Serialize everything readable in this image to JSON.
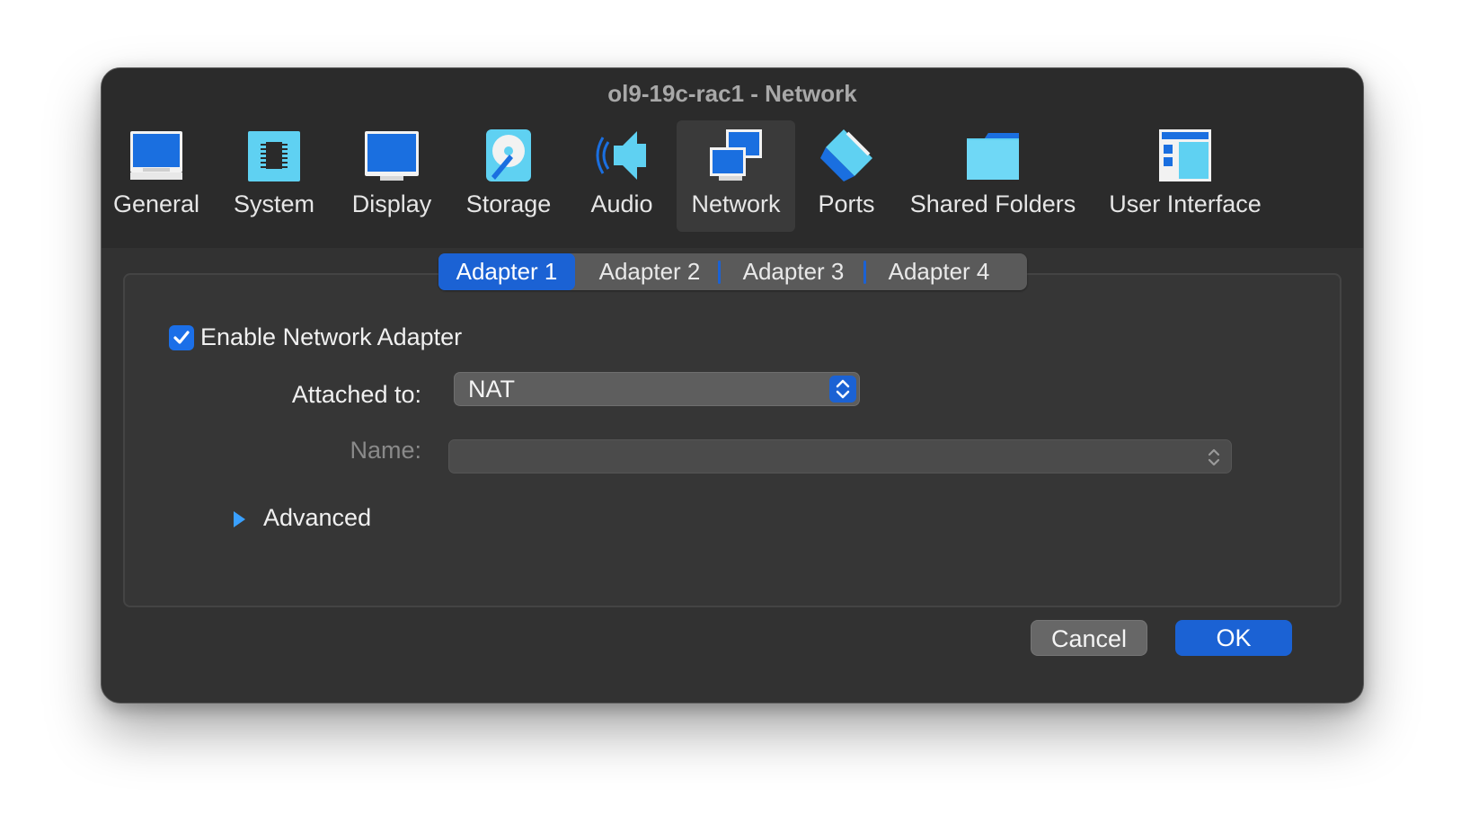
{
  "window": {
    "title": "ol9-19c-rac1 - Network"
  },
  "toolbar": {
    "items": [
      {
        "label": "General",
        "icon": "general-icon"
      },
      {
        "label": "System",
        "icon": "system-chip-icon"
      },
      {
        "label": "Display",
        "icon": "display-monitor-icon"
      },
      {
        "label": "Storage",
        "icon": "storage-disk-icon"
      },
      {
        "label": "Audio",
        "icon": "audio-speaker-icon"
      },
      {
        "label": "Network",
        "icon": "network-icon",
        "selected": true
      },
      {
        "label": "Ports",
        "icon": "ports-plug-icon"
      },
      {
        "label": "Shared Folders",
        "icon": "folder-icon"
      },
      {
        "label": "User Interface",
        "icon": "user-interface-icon"
      }
    ]
  },
  "adapters": {
    "tabs": [
      "Adapter 1",
      "Adapter 2",
      "Adapter 3",
      "Adapter 4"
    ],
    "selected": "Adapter 1"
  },
  "form": {
    "enable_label": "Enable Network Adapter",
    "enable_checked": true,
    "attached_label": "Attached to:",
    "attached_value": "NAT",
    "name_label": "Name:",
    "name_value": "",
    "advanced_label": "Advanced"
  },
  "buttons": {
    "cancel": "Cancel",
    "ok": "OK"
  },
  "colors": {
    "accent": "#1b62d4",
    "window_bg": "#323232",
    "toolbar_bg": "#2b2b2b"
  }
}
